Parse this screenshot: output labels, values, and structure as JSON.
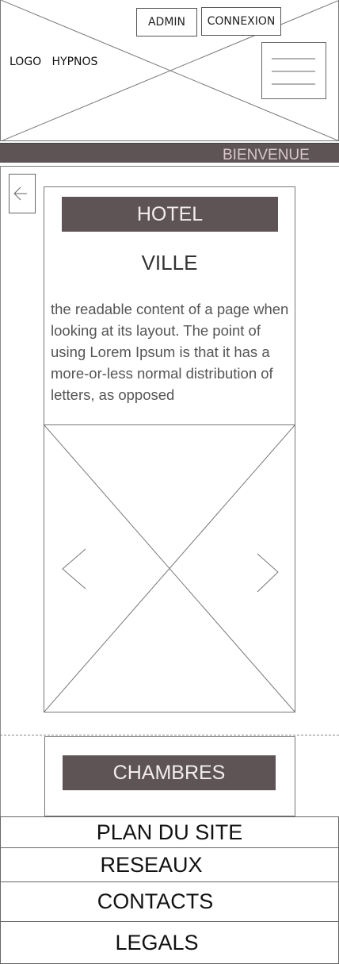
{
  "header": {
    "logo_text": "LOGO   HYPNOS",
    "admin_label": "ADMIN",
    "connexion_label": "CONNEXION",
    "menu_icon": "hamburger-icon",
    "welcome_text": "BIENVENUE"
  },
  "card": {
    "back_icon": "arrow-left-icon",
    "hotel_label": "HOTEL",
    "city_label": "VILLE",
    "description": "the readable content of a page when looking at its layout. The point of using Lorem Ipsum is that it has a more-or-less normal distribution of letters, as opposed",
    "prev_icon": "chevron-left-icon",
    "next_icon": "chevron-right-icon"
  },
  "rooms": {
    "label": "CHAMBRES"
  },
  "footer": {
    "items": [
      {
        "label": "PLAN DU SITE"
      },
      {
        "label": "RESEAUX"
      },
      {
        "label": "CONTACTS"
      },
      {
        "label": "LEGALS"
      }
    ]
  },
  "colors": {
    "accent_bar": "#5e5456",
    "accent_text": "#f2eeee",
    "welcome_text": "#d9c7cb"
  }
}
